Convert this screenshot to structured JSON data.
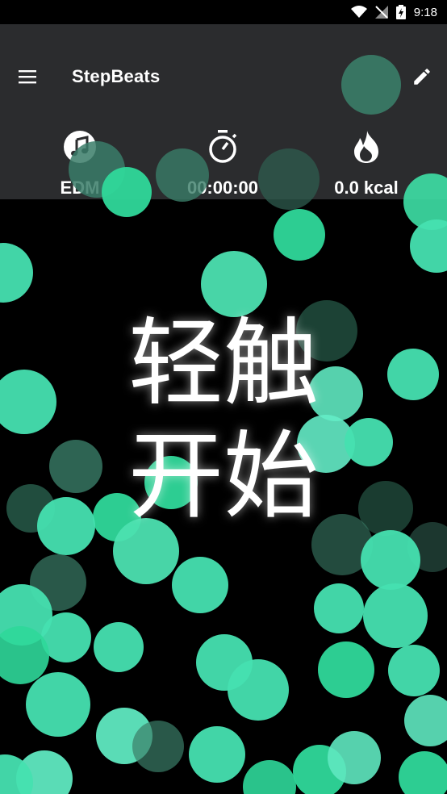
{
  "status_bar": {
    "time": "9:18"
  },
  "app": {
    "title": "StepBeats"
  },
  "stats": {
    "genre": "EDM",
    "elapsed": "00:00:00",
    "calories": "0.0 kcal"
  },
  "main": {
    "start_line1": "轻触",
    "start_line2": "开始"
  },
  "colors": {
    "accent": "#3ee0a6",
    "appbar": "#2b2c2e",
    "background": "#000000"
  }
}
